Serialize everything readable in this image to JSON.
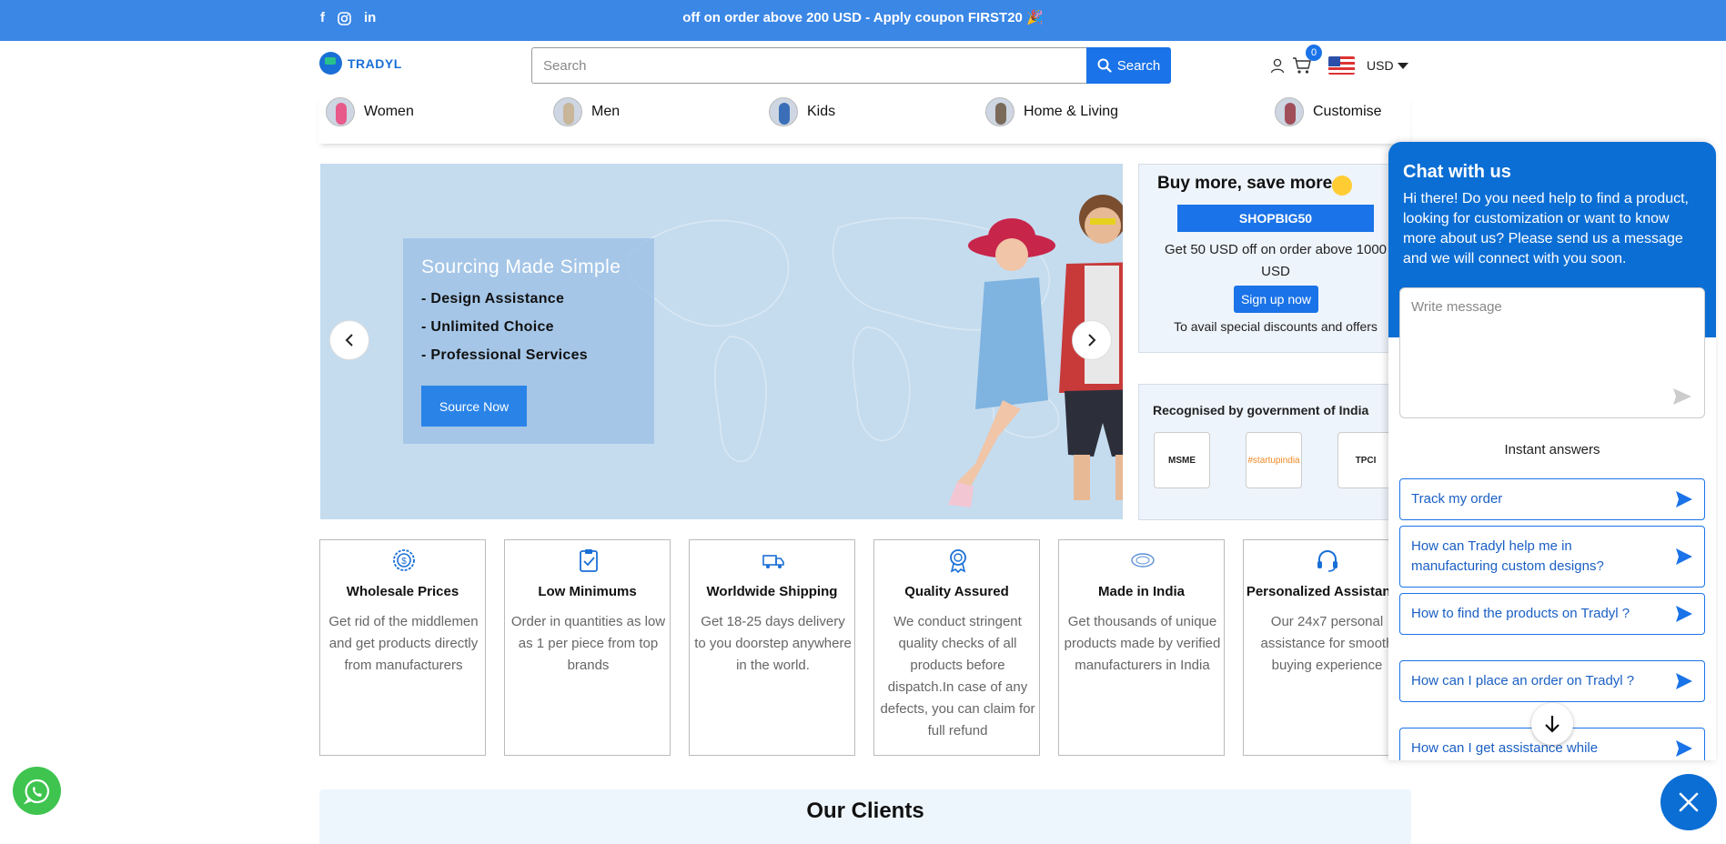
{
  "topbar": {
    "social": [
      "f",
      "ig",
      "in"
    ],
    "promo_text": "off on order above 200 USD - Apply coupon FIRST20 🎉"
  },
  "header": {
    "logo_text": "TRADYL",
    "search_placeholder": "Search",
    "search_button": "Search",
    "cart_count": "0",
    "currency": "USD"
  },
  "categories": [
    {
      "label": "Women",
      "color": "#e85a8a"
    },
    {
      "label": "Men",
      "color": "#c8b59a"
    },
    {
      "label": "Kids",
      "color": "#3a6fb8"
    },
    {
      "label": "Home & Living",
      "color": "#7a6a5a"
    },
    {
      "label": "Customise",
      "color": "#a04e5a"
    }
  ],
  "hero": {
    "title": "Sourcing Made Simple",
    "lines": [
      "- Design Assistance",
      "- Unlimited Choice",
      "- Professional Services"
    ],
    "cta": "Source Now",
    "prev": "‹",
    "next": "›"
  },
  "promo_card": {
    "title": "Buy more, save more",
    "code": "SHOPBIG50",
    "desc": "Get 50 USD off on order above 1000 USD",
    "signup": "Sign up now",
    "avail": "To avail special discounts and offers"
  },
  "recognition": {
    "title": "Recognised by government of India",
    "badges": [
      "MSME",
      "#startupindia",
      "TPCI"
    ]
  },
  "features": [
    {
      "title": "Wholesale Prices",
      "desc": "Get rid of the middlemen and get products directly from manufacturers",
      "icon": "dollar-badge-icon"
    },
    {
      "title": "Low Minimums",
      "desc": "Order in quantities as low as 1 per piece from top brands",
      "icon": "clipboard-check-icon"
    },
    {
      "title": "Worldwide Shipping",
      "desc": "Get 18-25 days delivery to you doorstep anywhere in the world.",
      "icon": "truck-icon"
    },
    {
      "title": "Quality Assured",
      "desc": "We conduct stringent quality checks of all products before dispatch.In case of any defects, you can claim for full refund",
      "icon": "award-icon"
    },
    {
      "title": "Made in India",
      "desc": "Get thousands of unique products made by verified manufacturers in India",
      "icon": "made-in-india-icon"
    },
    {
      "title": "Personalized Assistance",
      "desc": "Our 24x7 personal assistance for smooth buying experience",
      "icon": "headset-icon"
    }
  ],
  "clients": {
    "title": "Our Clients"
  },
  "chat": {
    "title": "Chat with us",
    "intro": "Hi there! Do you need help to find a product, looking for customization or want to know more about us? Please send us a message and we will connect with you soon.",
    "message_placeholder": "Write message",
    "instant_title": "Instant answers",
    "questions": [
      "Track my order",
      "How can Tradyl help me in manufacturing custom designs?",
      "How to find the products on Tradyl ?",
      "How can I place an order on Tradyl ?",
      "How can I get assistance while"
    ]
  },
  "colors": {
    "brand": "#1a73e8",
    "topbar": "#3b87e6",
    "chat": "#0b6ed4",
    "whatsapp": "#3ec44f"
  }
}
